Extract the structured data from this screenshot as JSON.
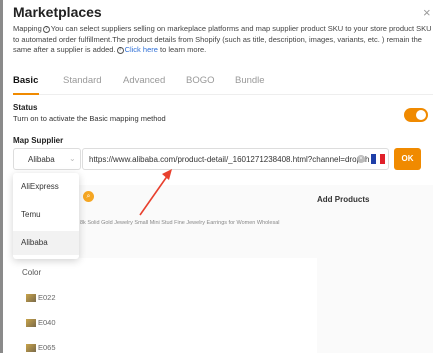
{
  "modal": {
    "title": "Marketplaces",
    "close_glyph": "×",
    "description_pre": "Mapping",
    "description_mid": "You can select suppliers selling on markeplace platforms and map supplier product SKU to your store product SKU to automated order fulfillment.The product details from Shopify (such as title, description, images, variants, etc. ) remain the same after a supplier is added.",
    "description_link": "Click here",
    "description_post": " to learn more.",
    "help_icon": "question-circle-icon",
    "accent_color": "#f08a00"
  },
  "tabs": [
    {
      "label": "Basic",
      "active": true
    },
    {
      "label": "Standard",
      "active": false
    },
    {
      "label": "Advanced",
      "active": false
    },
    {
      "label": "BOGO",
      "active": false
    },
    {
      "label": "Bundle",
      "active": false
    }
  ],
  "status": {
    "title": "Status",
    "description": "Turn on to activate the Basic mapping method",
    "enabled": true
  },
  "map_supplier": {
    "title": "Map Supplier",
    "selected": "Alibaba",
    "url": "https://www.alibaba.com/product-detail/_1601271238408.html?channel=dropsh",
    "ok_label": "OK",
    "options": [
      "AliExpress",
      "Temu",
      "Alibaba"
    ],
    "flag_colors": [
      "#1f3fa8",
      "#ffffff",
      "#e0202a"
    ]
  },
  "product": {
    "title_fragment": "8k Solid Gold Jewelry Small Mini Stud Fine Jewelry Earrings for Women Wholesal",
    "add_products_label": "Add Products"
  },
  "variants": {
    "label": "Color",
    "items": [
      "E022",
      "E040",
      "E065"
    ]
  }
}
